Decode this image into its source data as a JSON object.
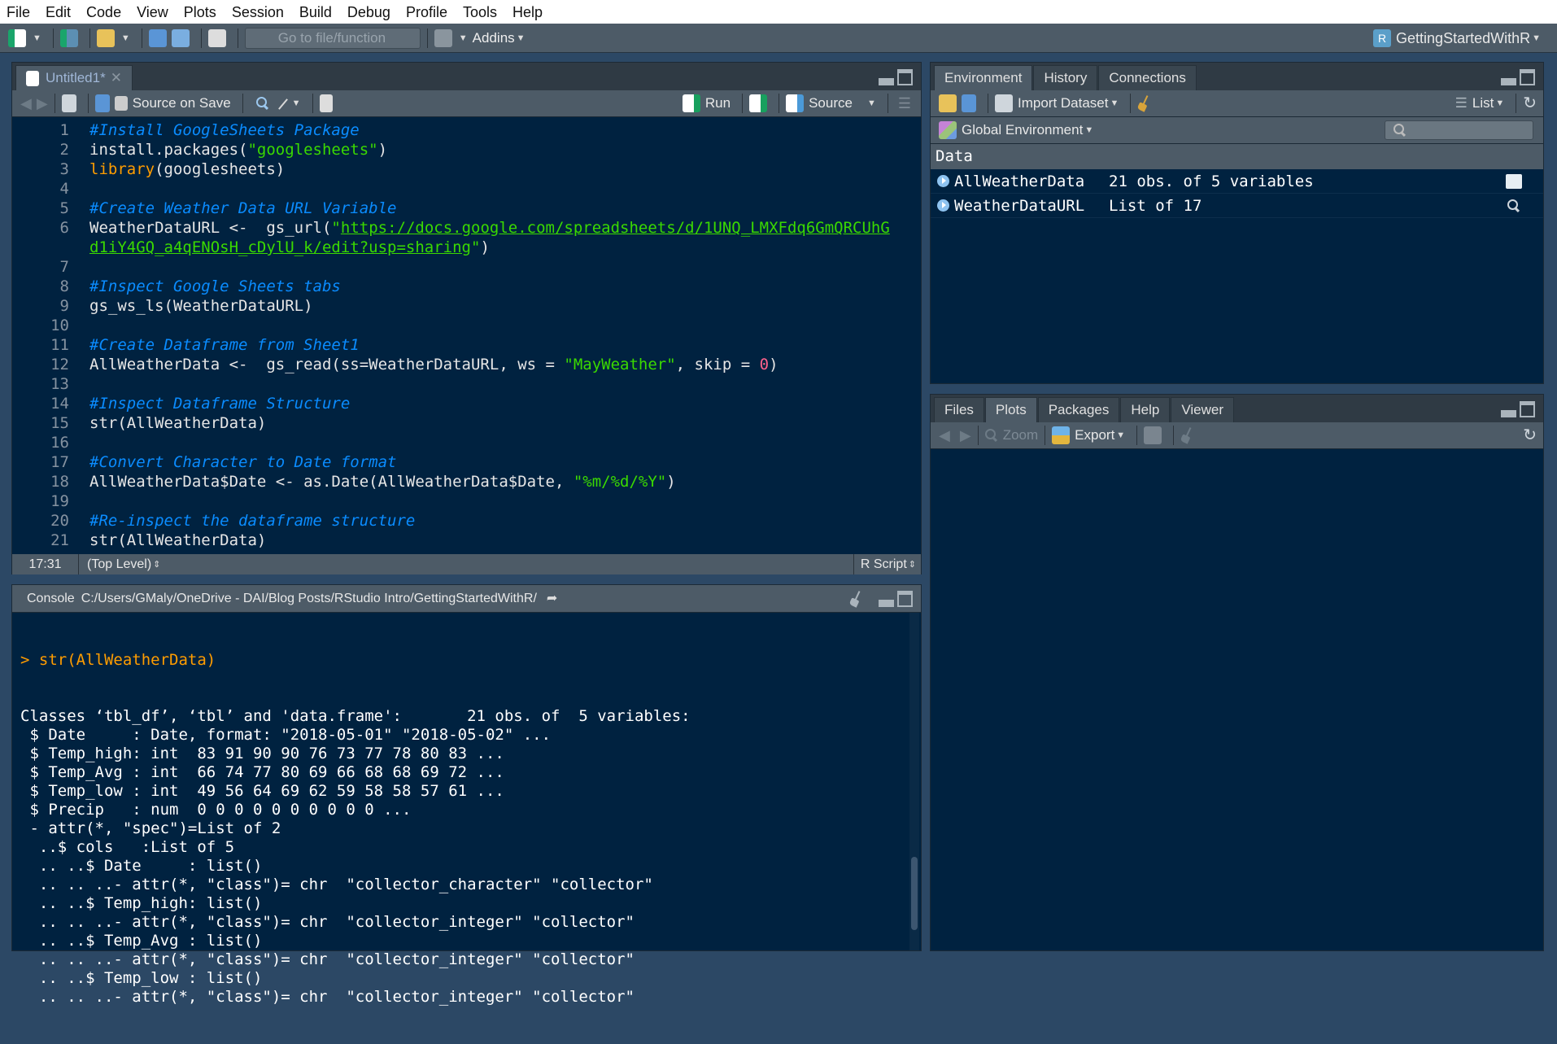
{
  "menu": [
    "File",
    "Edit",
    "Code",
    "View",
    "Plots",
    "Session",
    "Build",
    "Debug",
    "Profile",
    "Tools",
    "Help"
  ],
  "toolbar": {
    "goto_placeholder": "Go to file/function",
    "addins": "Addins",
    "project": "GettingStartedWithR"
  },
  "editor": {
    "tab": "Untitled1*",
    "source_on_save": "Source on Save",
    "run": "Run",
    "source": "Source",
    "lines": [
      {
        "n": "1",
        "segs": [
          [
            "cmt",
            "#Install GoogleSheets Package"
          ]
        ]
      },
      {
        "n": "2",
        "segs": [
          [
            "txt",
            "install.packages("
          ],
          [
            "str",
            "\"googlesheets\""
          ],
          [
            "txt",
            ")"
          ]
        ]
      },
      {
        "n": "3",
        "segs": [
          [
            "kw",
            "library"
          ],
          [
            "txt",
            "(googlesheets)"
          ]
        ]
      },
      {
        "n": "4",
        "segs": []
      },
      {
        "n": "5",
        "segs": [
          [
            "cmt",
            "#Create Weather Data URL Variable"
          ]
        ]
      },
      {
        "n": "6",
        "segs": [
          [
            "txt",
            "WeatherDataURL <-  gs_url("
          ],
          [
            "str",
            "\""
          ],
          [
            "url",
            "https://docs.google.com/spreadsheets/d/1UNQ_LMXFdq6GmQRCUhG"
          ]
        ]
      },
      {
        "n": "",
        "segs": [
          [
            "url",
            "d1iY4GQ_a4qENOsH_cDylU_k/edit?usp=sharing"
          ],
          [
            "str",
            "\""
          ],
          [
            "txt",
            ")"
          ]
        ]
      },
      {
        "n": "7",
        "segs": []
      },
      {
        "n": "8",
        "segs": [
          [
            "cmt",
            "#Inspect Google Sheets tabs"
          ]
        ]
      },
      {
        "n": "9",
        "segs": [
          [
            "txt",
            "gs_ws_ls(WeatherDataURL)"
          ]
        ]
      },
      {
        "n": "10",
        "segs": []
      },
      {
        "n": "11",
        "segs": [
          [
            "cmt",
            "#Create Dataframe from Sheet1"
          ]
        ]
      },
      {
        "n": "12",
        "segs": [
          [
            "txt",
            "AllWeatherData <-  gs_read(ss=WeatherDataURL, ws = "
          ],
          [
            "str",
            "\"MayWeather\""
          ],
          [
            "txt",
            ", skip = "
          ],
          [
            "num",
            "0"
          ],
          [
            "txt",
            ")"
          ]
        ]
      },
      {
        "n": "13",
        "segs": []
      },
      {
        "n": "14",
        "segs": [
          [
            "cmt",
            "#Inspect Dataframe Structure"
          ]
        ]
      },
      {
        "n": "15",
        "segs": [
          [
            "txt",
            "str(AllWeatherData)"
          ]
        ]
      },
      {
        "n": "16",
        "segs": []
      },
      {
        "n": "17",
        "segs": [
          [
            "cmt",
            "#Convert Character to Date format"
          ]
        ]
      },
      {
        "n": "18",
        "segs": [
          [
            "txt",
            "AllWeatherData$Date <- as.Date(AllWeatherData$Date, "
          ],
          [
            "str",
            "\"%m/%d/%Y\""
          ],
          [
            "txt",
            ")"
          ]
        ]
      },
      {
        "n": "19",
        "segs": []
      },
      {
        "n": "20",
        "segs": [
          [
            "cmt",
            "#Re-inspect the dataframe structure"
          ]
        ]
      },
      {
        "n": "21",
        "segs": [
          [
            "txt",
            "str(AllWeatherData)"
          ]
        ]
      }
    ],
    "status": {
      "position": "17:31",
      "scope": "(Top Level)",
      "filetype": "R Script"
    }
  },
  "console": {
    "label": "Console",
    "path": "C:/Users/GMaly/OneDrive - DAI/Blog Posts/RStudio Intro/GettingStartedWithR/",
    "prompt_line": "> str(AllWeatherData)",
    "lines": [
      "Classes ‘tbl_df’, ‘tbl’ and 'data.frame':\t21 obs. of  5 variables:",
      " $ Date     : Date, format: \"2018-05-01\" \"2018-05-02\" ...",
      " $ Temp_high: int  83 91 90 90 76 73 77 78 80 83 ...",
      " $ Temp_Avg : int  66 74 77 80 69 66 68 68 69 72 ...",
      " $ Temp_low : int  49 56 64 69 62 59 58 58 57 61 ...",
      " $ Precip   : num  0 0 0 0 0 0 0 0 0 0 ...",
      " - attr(*, \"spec\")=List of 2",
      "  ..$ cols   :List of 5",
      "  .. ..$ Date     : list()",
      "  .. .. ..- attr(*, \"class\")= chr  \"collector_character\" \"collector\"",
      "  .. ..$ Temp_high: list()",
      "  .. .. ..- attr(*, \"class\")= chr  \"collector_integer\" \"collector\"",
      "  .. ..$ Temp_Avg : list()",
      "  .. .. ..- attr(*, \"class\")= chr  \"collector_integer\" \"collector\"",
      "  .. ..$ Temp_low : list()",
      "  .. .. ..- attr(*, \"class\")= chr  \"collector_integer\" \"collector\""
    ]
  },
  "environment": {
    "tabs": [
      "Environment",
      "History",
      "Connections"
    ],
    "import_dataset": "Import Dataset",
    "view_mode": "List",
    "scope": "Global Environment",
    "section": "Data",
    "rows": [
      {
        "name": "AllWeatherData",
        "value": "21 obs. of 5 variables",
        "icon": "table-icon"
      },
      {
        "name": "WeatherDataURL",
        "value": "List of 17",
        "icon": "search-icon"
      }
    ]
  },
  "files": {
    "tabs": [
      "Files",
      "Plots",
      "Packages",
      "Help",
      "Viewer"
    ],
    "active_tab": "Plots",
    "zoom": "Zoom",
    "export": "Export"
  }
}
